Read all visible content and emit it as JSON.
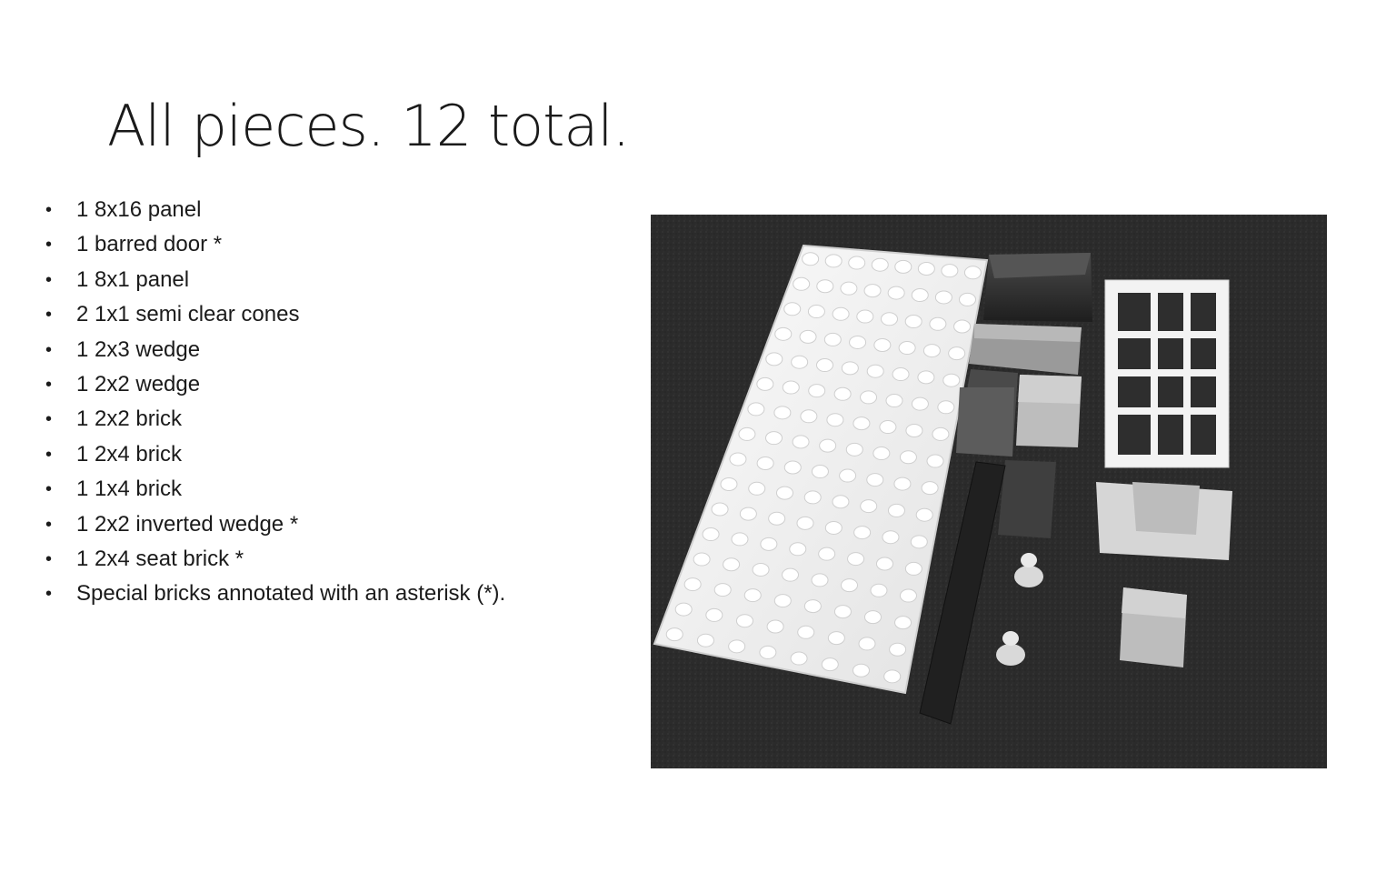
{
  "slide": {
    "title": "All pieces. 12 total."
  },
  "pieces_list": [
    "1  8x16  panel",
    "1  barred door *",
    "1  8x1  panel",
    "2  1x1  semi clear cones",
    "1  2x3  wedge",
    "1  2x2  wedge",
    "1  2x2  brick",
    "1  2x4  brick",
    "1  1x4  brick",
    "1  2x2  inverted wedge *",
    "1  2x4  seat brick *",
    "Special bricks annotated with an asterisk (*)."
  ],
  "bullet_glyph": "•",
  "photo": {
    "subject": "grayscale photo of lego pieces on dark surface",
    "colors": {
      "background": "#2a2a2a",
      "plate": "#f2f2f2",
      "dark_brick": "#3a3a3a",
      "mid_brick": "#a8a8a8",
      "light_brick": "#d8d8d8"
    }
  }
}
